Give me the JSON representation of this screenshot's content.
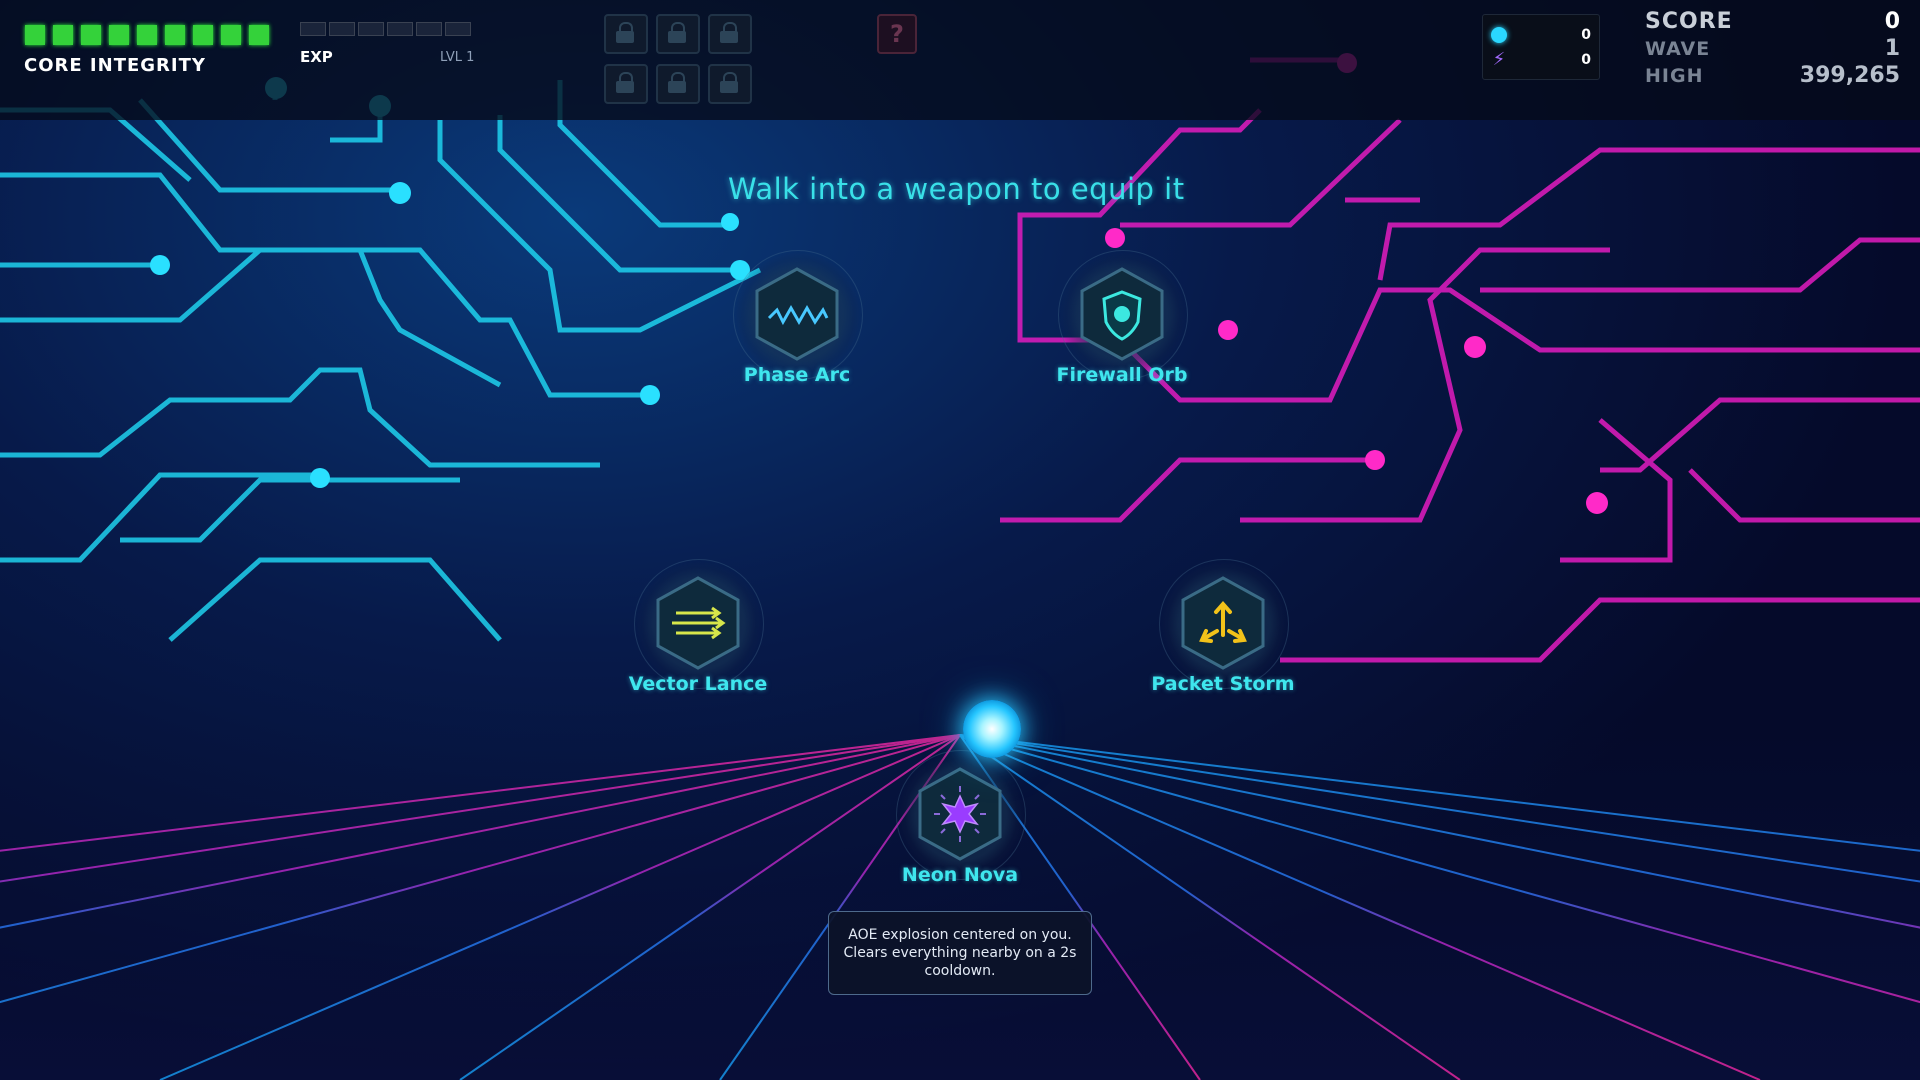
{
  "hud": {
    "core_integrity_label": "CORE INTEGRITY",
    "core_integrity_segments": 9,
    "core_integrity_filled": 9,
    "exp_label": "EXP",
    "exp_progress": 0,
    "level_label": "LVL 1",
    "locked_slots": 6,
    "mystery_label": "?",
    "resources": [
      {
        "icon": "cyan-orb-icon",
        "value": "0"
      },
      {
        "icon": "lightning-bolt-icon",
        "value": "0"
      }
    ],
    "score_label": "SCORE",
    "score_value": "0",
    "wave_label": "WAVE",
    "wave_value": "1",
    "high_label": "HIGH",
    "high_value": "399,265"
  },
  "instruction": "Walk into a weapon to equip it",
  "weapons": [
    {
      "id": "phase-arc",
      "name": "Phase Arc",
      "icon": "zigzag-wave-icon"
    },
    {
      "id": "firewall-orb",
      "name": "Firewall Orb",
      "icon": "shield-orb-icon"
    },
    {
      "id": "vector-lance",
      "name": "Vector Lance",
      "icon": "triple-arrow-icon"
    },
    {
      "id": "packet-storm",
      "name": "Packet Storm",
      "icon": "spread-arrows-icon"
    },
    {
      "id": "neon-nova",
      "name": "Neon Nova",
      "icon": "burst-star-icon"
    }
  ],
  "tooltip": {
    "text": "AOE explosion centered on you. Clears everything nearby on a 2s cooldown."
  },
  "colors": {
    "accent_cyan": "#3fe6ee",
    "accent_magenta": "#e21cc0",
    "health_green": "#34d23a",
    "player_blue": "#26c6ff"
  }
}
